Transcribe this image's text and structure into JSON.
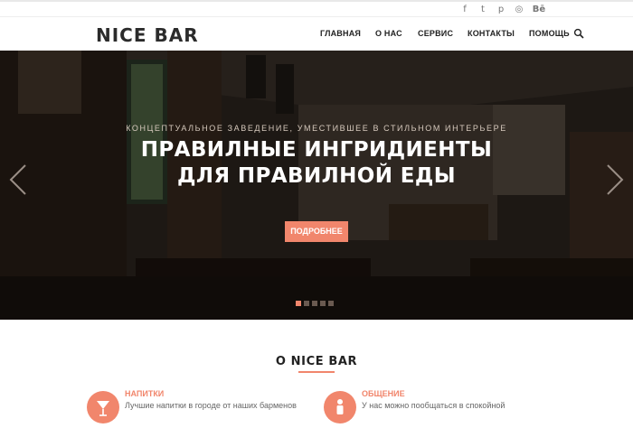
{
  "social": {
    "icons": [
      "facebook-icon",
      "twitter-icon",
      "pinterest-icon",
      "dribbble-icon",
      "behance-icon"
    ],
    "glyphs": [
      "f",
      "t",
      "p",
      "◎",
      "Bē"
    ]
  },
  "brand": {
    "logo": "NICE BAR"
  },
  "nav": {
    "items": [
      "ГЛАВНАЯ",
      "О НАС",
      "СЕРВИС",
      "КОНТАКТЫ",
      "ПОМОЩЬ"
    ]
  },
  "hero": {
    "subtitle": "КОНЦЕПТУАЛЬНОЕ ЗАВЕДЕНИЕ, УМЕСТИВШЕЕ В СТИЛЬНОМ ИНТЕРЬЕРЕ",
    "title_line1": "ПРАВИЛНЫЕ ИНГРИДИЕНТЫ",
    "title_line2": "ДЛЯ ПРАВИЛНОЙ ЕДЫ",
    "button": "ПОДРОБНЕЕ",
    "slides_total": 5,
    "active_slide": 1
  },
  "about": {
    "title": "О NICE BAR",
    "features": [
      {
        "title": "НАПИТКИ",
        "text": "Лучшие напитки в городе от наших барменов"
      },
      {
        "title": "ОБЩЕНИЕ",
        "text": "У нас можно пообщаться в спокойной"
      }
    ]
  },
  "colors": {
    "accent": "#f1866c",
    "text": "#222222"
  }
}
